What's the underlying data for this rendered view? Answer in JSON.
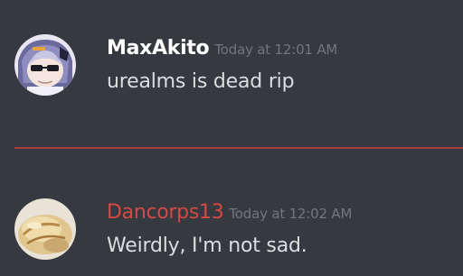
{
  "messages": [
    {
      "author": "MaxAkito",
      "timestamp": "Today at 12:01 AM",
      "content": "urealms is dead rip",
      "name_color": "#ffffff"
    },
    {
      "author": "Dancorps13",
      "timestamp": "Today at 12:02 AM",
      "content": "Weirdly, I'm not sad.",
      "name_color": "#d34a45"
    }
  ],
  "colors": {
    "background": "#36393f",
    "divider": "#ab3c3f",
    "timestamp": "#72767d",
    "message_text": "#dcddde"
  }
}
